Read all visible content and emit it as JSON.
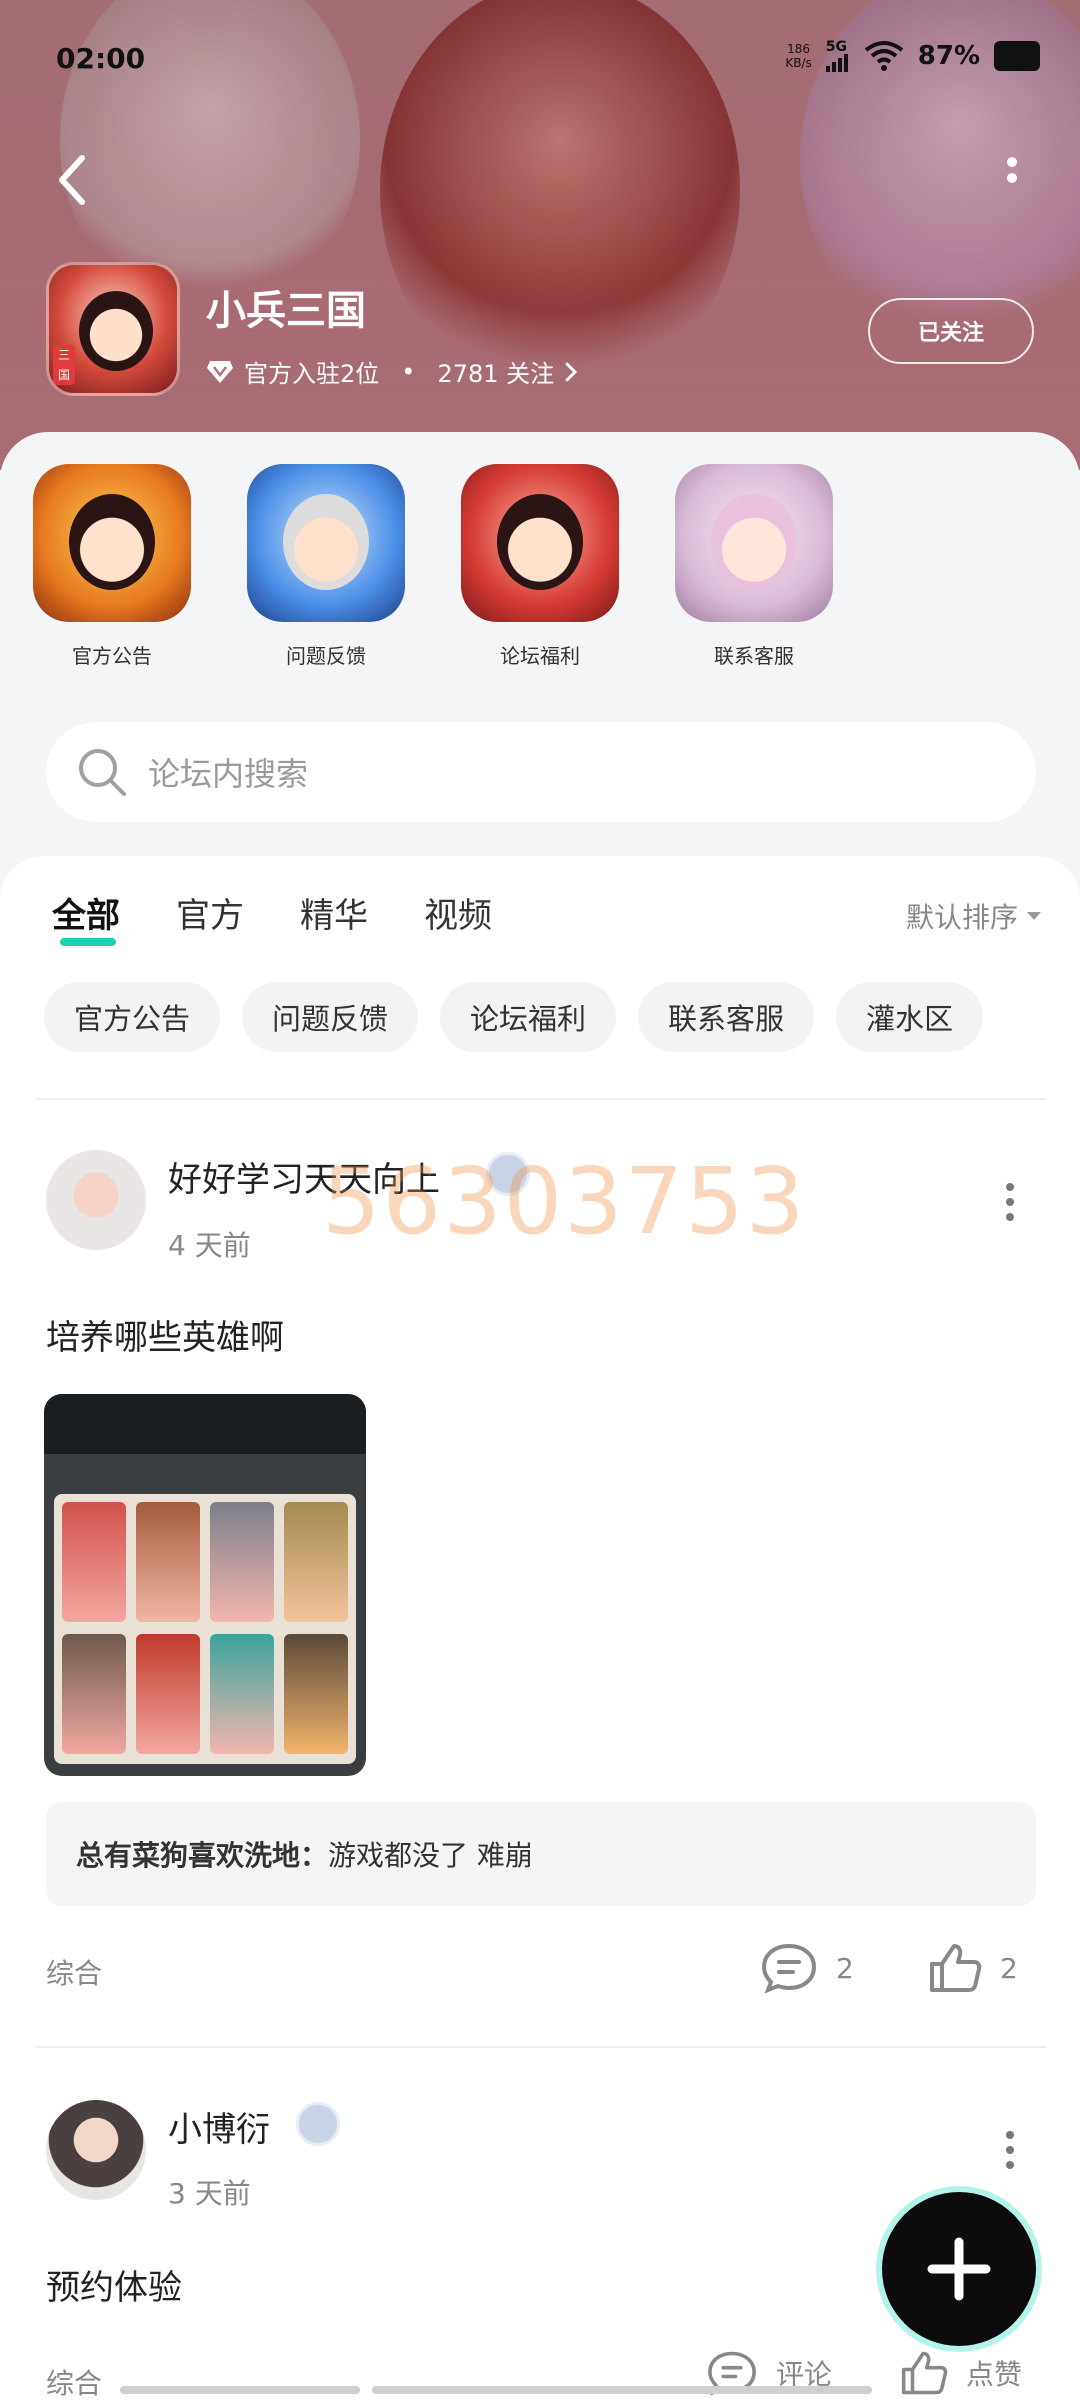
{
  "status_bar": {
    "time": "02:00",
    "net_speed": "186",
    "net_unit": "KB/s",
    "signal": "5G",
    "battery": "87%"
  },
  "header": {
    "game_name": "小兵三国",
    "official_rank": "官方入驻2位",
    "followers": "2781 关注",
    "follow_label": "已关注",
    "icon_tag": "三国"
  },
  "shortcuts": [
    {
      "label": "官方公告"
    },
    {
      "label": "问题反馈"
    },
    {
      "label": "论坛福利"
    },
    {
      "label": "联系客服"
    }
  ],
  "search": {
    "placeholder": "论坛内搜索"
  },
  "tabs": [
    {
      "label": "全部",
      "active": true
    },
    {
      "label": "官方"
    },
    {
      "label": "精华"
    },
    {
      "label": "视频"
    }
  ],
  "sort_label": "默认排序",
  "chips": [
    "官方公告",
    "问题反馈",
    "论坛福利",
    "联系客服",
    "灌水区"
  ],
  "watermark": "56303753",
  "posts": [
    {
      "user": "好好学习天天向上",
      "time": "4 天前",
      "title": "培养哪些英雄啊",
      "comment_author": "总有菜狗喜欢洗地：",
      "comment_text": "游戏都没了 难崩",
      "category": "综合",
      "comments": "2",
      "likes": "2"
    },
    {
      "user": "小博衍",
      "time": "3 天前",
      "title": "预约体验",
      "category": "综合",
      "comments": "评论",
      "likes": "点赞"
    }
  ],
  "colors": {
    "accent": "#1fd1b4",
    "header_bg": "#b4767f"
  }
}
